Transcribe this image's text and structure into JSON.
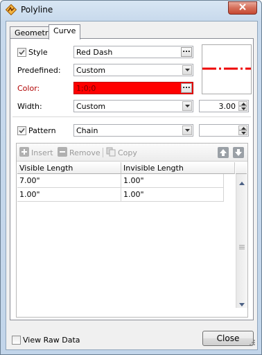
{
  "window": {
    "title": "Polyline"
  },
  "tabs": [
    {
      "label": "Geometry"
    },
    {
      "label": "Curve"
    }
  ],
  "curve": {
    "style": {
      "label": "Style",
      "value": "Red Dash",
      "checked": true
    },
    "predefined": {
      "label": "Predefined:",
      "value": "Custom"
    },
    "color": {
      "label": "Color:",
      "value": "1;0;0",
      "swatch": "#ff0000"
    },
    "width": {
      "label": "Width:",
      "value": "Custom",
      "number": "3.00"
    },
    "pattern": {
      "label": "Pattern",
      "value": "Chain",
      "checked": true,
      "number": ""
    }
  },
  "toolbar": {
    "insert_label": "Insert",
    "remove_label": "Remove",
    "copy_label": "Copy"
  },
  "table": {
    "columns": [
      "Visible Length",
      "Invisible Length"
    ],
    "rows": [
      [
        "7.00\"",
        "1.00\""
      ],
      [
        "1.00\"",
        "1.00\""
      ]
    ]
  },
  "footer": {
    "raw_data_label": "View Raw Data",
    "raw_data_checked": false,
    "close_label": "Close"
  },
  "icons": {
    "app": "polyline-app-icon",
    "close": "close-x-icon",
    "up": "arrow-up-icon",
    "down": "arrow-down-icon"
  }
}
